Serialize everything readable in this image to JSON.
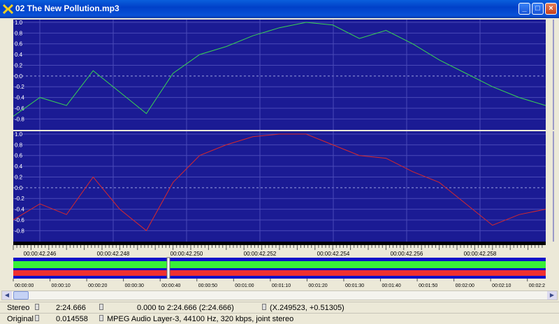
{
  "window": {
    "title": "02 The New Pollution.mp3",
    "minimize_label": "_",
    "maximize_label": "□",
    "close_label": "×"
  },
  "waveform": {
    "y_ticks": [
      "1.0",
      "0.8",
      "0.6",
      "0.4",
      "0.2",
      "0.0",
      "-0.2",
      "-0.4",
      "-0.6",
      "-0.8"
    ],
    "time_ticks": [
      "00:00:42.246",
      "00:00:42.248",
      "00:00:42.250",
      "00:00:42.252",
      "00:00:42.254",
      "00:00:42.256",
      "00:00:42.258"
    ],
    "overview_ticks": [
      "00:00:00",
      "00:00:10",
      "00:00:20",
      "00:00:30",
      "00:00:40",
      "00:00:50",
      "00:01:00",
      "00:01:10",
      "00:01:20",
      "00:01:30",
      "00:01:40",
      "00:01:50",
      "00:02:00",
      "00:02:10",
      "00:02:2"
    ],
    "colors": {
      "background": "#1b1b94",
      "grid": "#4a4ab8",
      "left_channel": "#39d352",
      "right_channel": "#d8282a",
      "overview_green": "#38f038",
      "overview_red": "#f03030",
      "overview_blue": "#1010c8"
    }
  },
  "chart_data": [
    {
      "type": "line",
      "xlabel": "",
      "ylabel": "",
      "ylim": [
        -0.9,
        1.0
      ],
      "x": [
        0,
        5,
        10,
        15,
        20,
        25,
        30,
        35,
        40,
        45,
        50,
        55,
        60,
        65,
        70,
        75,
        80,
        85,
        90,
        95,
        100
      ],
      "series": [
        {
          "values": [
            -0.75,
            -0.4,
            -0.55,
            0.1,
            -0.3,
            -0.7,
            0.05,
            0.4,
            0.55,
            0.75,
            0.9,
            1.0,
            0.95,
            0.7,
            0.85,
            0.6,
            0.3,
            0.05,
            -0.2,
            -0.4,
            -0.55
          ]
        },
        {
          "values": [
            -0.6,
            -0.3,
            -0.5,
            0.2,
            -0.4,
            -0.8,
            0.1,
            0.6,
            0.8,
            0.95,
            1.0,
            1.0,
            0.8,
            0.6,
            0.55,
            0.3,
            0.1,
            -0.3,
            -0.7,
            -0.5,
            -0.4
          ]
        }
      ]
    }
  ],
  "status": {
    "row1": {
      "channels": "Stereo",
      "length": "2:24.666",
      "selection": "0.000 to 2:24.666 (2:24.666)",
      "cursor": "(X.249523, +0.51305)"
    },
    "row2": {
      "label": "Original",
      "value": "0.014558",
      "format": "MPEG Audio Layer-3, 44100 Hz, 320 kbps, joint stereo"
    }
  }
}
